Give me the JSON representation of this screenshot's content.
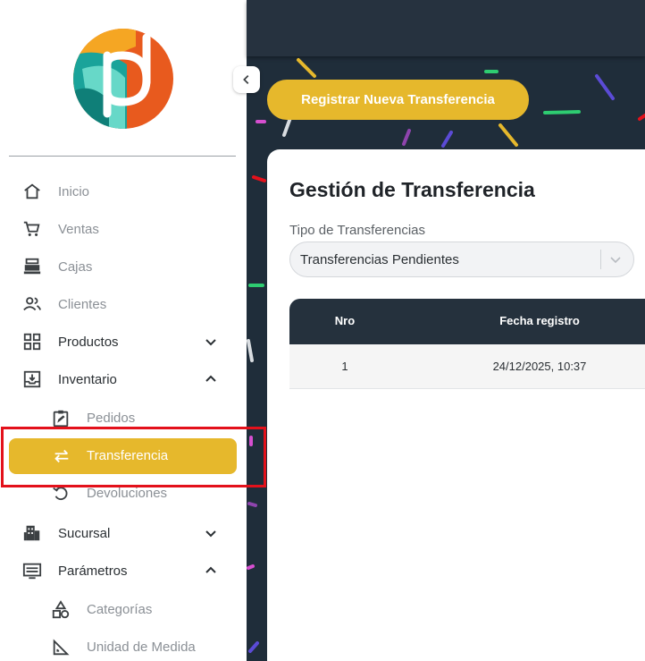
{
  "sidebar": {
    "items": [
      {
        "label": "Inicio",
        "icon": "home-icon"
      },
      {
        "label": "Ventas",
        "icon": "cart-icon"
      },
      {
        "label": "Cajas",
        "icon": "cash-register-icon"
      },
      {
        "label": "Clientes",
        "icon": "users-icon"
      },
      {
        "label": "Productos",
        "icon": "grid-icon",
        "chevron": "down"
      },
      {
        "label": "Inventario",
        "icon": "inbox-icon",
        "chevron": "up"
      },
      {
        "label": "Sucursal",
        "icon": "building-icon",
        "chevron": "down"
      },
      {
        "label": "Parámetros",
        "icon": "sliders-icon",
        "chevron": "up"
      }
    ],
    "inventario_sub": [
      {
        "label": "Pedidos",
        "icon": "clipboard-edit-icon"
      },
      {
        "label": "Transferencia",
        "icon": "swap-icon",
        "active": true
      },
      {
        "label": "Devoluciones",
        "icon": "undo-icon"
      }
    ],
    "parametros_sub": [
      {
        "label": "Categorías",
        "icon": "shapes-icon"
      },
      {
        "label": "Unidad de Medida",
        "icon": "ruler-icon"
      }
    ]
  },
  "main": {
    "new_button": "Registrar Nueva Transferencia",
    "card_title": "Gestión de Transferencia",
    "filter_label": "Tipo de Transferencias",
    "filter_value": "Transferencias Pendientes",
    "table": {
      "columns": [
        "Nro",
        "Fecha registro"
      ],
      "rows": [
        [
          "1",
          "24/12/2025, 10:37"
        ]
      ]
    }
  },
  "colors": {
    "accent": "#e6b82c",
    "dark": "#1f2d3a",
    "highlight": "#e3111b"
  }
}
